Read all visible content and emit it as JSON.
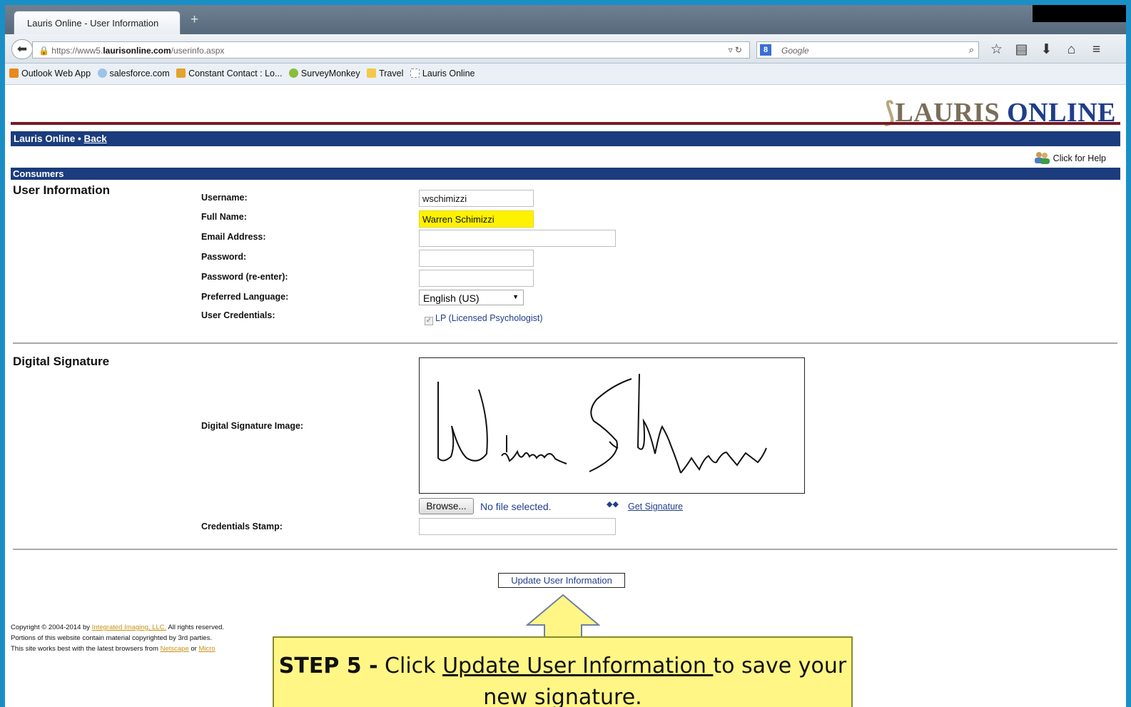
{
  "browser": {
    "tab_title": "Lauris Online - User Information",
    "newtab_symbol": "+",
    "url_prefix": "https://www5.",
    "url_domain": "laurisonline.com",
    "url_path": "/userinfo.aspx",
    "search_engine_letter": "8",
    "search_placeholder": "Google"
  },
  "bookmarks": [
    {
      "label": "Outlook Web App",
      "color": "#e8891d"
    },
    {
      "label": "salesforce.com",
      "color": "#9bc4e8"
    },
    {
      "label": "Constant Contact : Lo...",
      "color": "#e3a32c"
    },
    {
      "label": "SurveyMonkey",
      "color": "#8bbd3a"
    },
    {
      "label": "Travel",
      "color": "#f3c94a"
    },
    {
      "label": "Lauris Online",
      "color": "#ffffff"
    }
  ],
  "header": {
    "logo_first": "L",
    "logo_rest": "AURIS ",
    "logo_second": "ONLINE",
    "nav_site": "Lauris Online",
    "nav_sep": " • ",
    "nav_back": "Back",
    "help_label": "Click for Help",
    "section_bar": "Consumers"
  },
  "user_info": {
    "title": "User Information",
    "username_label": "Username:",
    "username_value": "wschimizzi",
    "fullname_label": "Full Name:",
    "fullname_value": "Warren Schimizzi",
    "email_label": "Email Address:",
    "email_value": "",
    "password_label": "Password:",
    "password_value": "",
    "password2_label": "Password (re-enter):",
    "password2_value": "",
    "language_label": "Preferred Language:",
    "language_value": "English (US)",
    "credentials_label": "User Credentials:",
    "credentials_value": "LP (Licensed Psychologist)"
  },
  "signature": {
    "title": "Digital Signature",
    "image_label": "Digital Signature Image:",
    "browse_label": "Browse...",
    "no_file": "No file selected.",
    "get_signature": "Get Signature",
    "stamp_label": "Credentials Stamp:",
    "stamp_value": ""
  },
  "update_button": "Update User Information",
  "footer": {
    "line1_prefix": "Copyright © 2004-2014 by ",
    "line1_link": "Integrated Imaging, LLC.",
    "line1_suffix": " All rights reserved.",
    "line2": "Portions of this website contain material copyrighted by 3rd parties.",
    "line3_prefix": "This site works best with the latest browsers from ",
    "line3_link1": "Netscape",
    "line3_mid": " or ",
    "line3_link2": "Micro"
  },
  "callout": {
    "step": "STEP 5 -",
    "text_pre": " Click ",
    "link_text": "Update User Information ",
    "text_post": "to save your new signature."
  },
  "colors": {
    "navy": "#1b3c7d",
    "callout_yellow": "#fff685",
    "highlight_yellow": "#fff200",
    "frame_blue": "#1a8fc6"
  }
}
